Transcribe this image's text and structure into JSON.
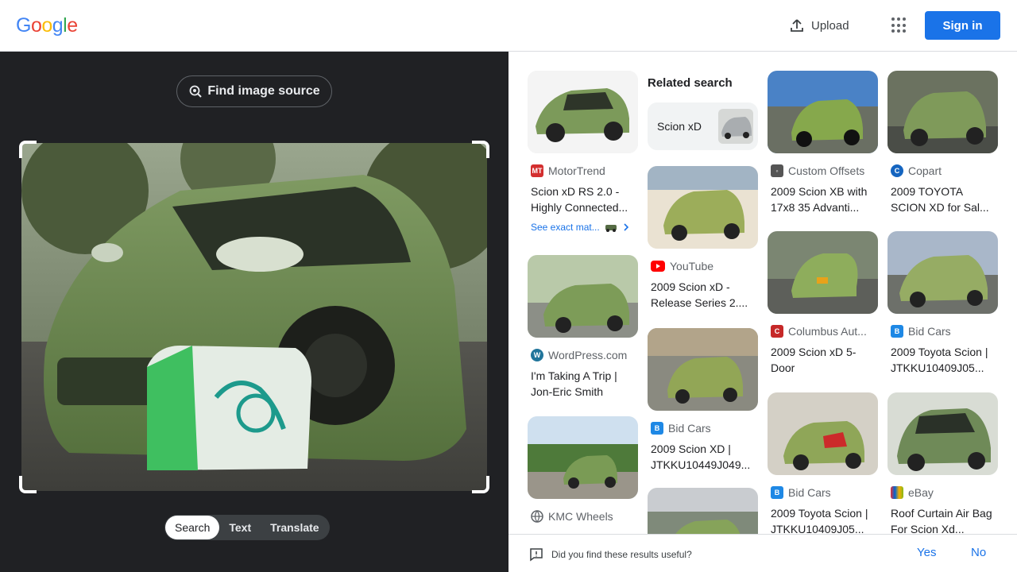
{
  "header": {
    "logo": [
      "G",
      "o",
      "o",
      "g",
      "l",
      "e"
    ],
    "upload_label": "Upload",
    "signin_label": "Sign in"
  },
  "left": {
    "find_source_label": "Find image source",
    "modes": [
      "Search",
      "Text",
      "Translate"
    ],
    "active_mode": "Search"
  },
  "related": {
    "title": "Related search",
    "chip_label": "Scion xD"
  },
  "results": [
    {
      "source": "MotorTrend",
      "title": "Scion xD RS 2.0 - Highly Connected...",
      "see_exact": "See exact mat...",
      "favicon": "mt-icon",
      "color": "#d32f2f"
    },
    {
      "source": "YouTube",
      "title": "2009 Scion xD - Release Series 2....",
      "favicon": "youtube-icon",
      "color": "#ff0000"
    },
    {
      "source": "WordPress.com",
      "title": "I'm Taking A Trip | Jon-Eric Smith",
      "favicon": "wordpress-icon",
      "color": "#21759b"
    },
    {
      "source": "Bid Cars",
      "title": "2009 Scion XD | JTKKU10449J049...",
      "favicon": "bidcars-icon",
      "color": "#1e88e5"
    },
    {
      "source": "KMC Wheels",
      "title": "",
      "favicon": "globe-icon",
      "color": "#5f6368"
    },
    {
      "source": "Custom Offsets",
      "title": "2009 Scion XB with 17x8 35 Advanti...",
      "favicon": "customoffsets-icon",
      "color": "#555555"
    },
    {
      "source": "Copart",
      "title": "2009 TOYOTA SCION XD for Sal...",
      "favicon": "copart-icon",
      "color": "#1565c0"
    },
    {
      "source": "Columbus Aut...",
      "title": "2009 Scion xD 5-Door",
      "favicon": "columbus-icon",
      "color": "#c62828"
    },
    {
      "source": "Bid Cars",
      "title": "2009 Toyota Scion | JTKKU10409J05...",
      "favicon": "bidcars-icon",
      "color": "#1e88e5"
    },
    {
      "source": "Bid Cars",
      "title": "2009 Toyota Scion | JTKKU10409J05...",
      "favicon": "bidcars-icon",
      "color": "#1e88e5"
    },
    {
      "source": "eBay",
      "title": "Roof Curtain Air Bag For Scion Xd...",
      "favicon": "ebay-icon",
      "color": "#e53238"
    }
  ],
  "footer": {
    "question": "Did you find these results useful?",
    "yes": "Yes",
    "no": "No"
  }
}
